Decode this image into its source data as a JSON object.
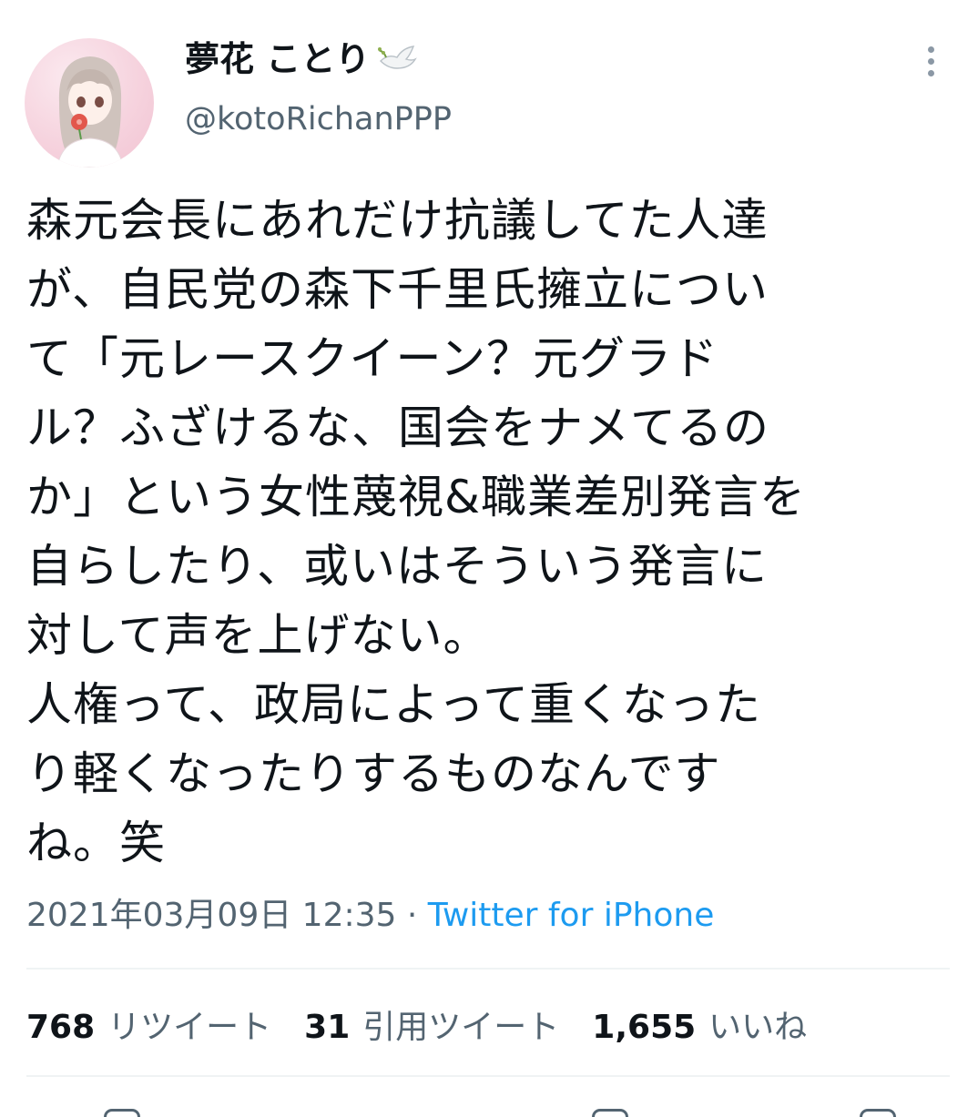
{
  "user": {
    "display_name": "夢花 ことり",
    "badge_icon": "dove-icon",
    "handle": "@kotoRichanPPP"
  },
  "tweet": {
    "lines": [
      "森元会長にあれだけ抗議してた人達",
      "が、自民党の森下千里氏擁立につい",
      "て「元レースクイーン？元グラド",
      "ル？ふざけるな、国会をナメてるの",
      "か」という女性蔑視&職業差別発言を",
      "自らしたり、或いはそういう発言に",
      "対して声を上げない。",
      "人権って、政局によって重くなった",
      "り軽くなったりするものなんです",
      "ね。笑"
    ],
    "timestamp": "2021年03月09日 12:35",
    "separator": " · ",
    "source": "Twitter for iPhone"
  },
  "stats": {
    "retweets": {
      "count": "768",
      "label": "リツイート"
    },
    "quotes": {
      "count": "31",
      "label": "引用ツイート"
    },
    "likes": {
      "count": "1,655",
      "label": "いいね"
    }
  },
  "icons": {
    "more": "more-vertical-icon",
    "avatar": "avatar"
  }
}
